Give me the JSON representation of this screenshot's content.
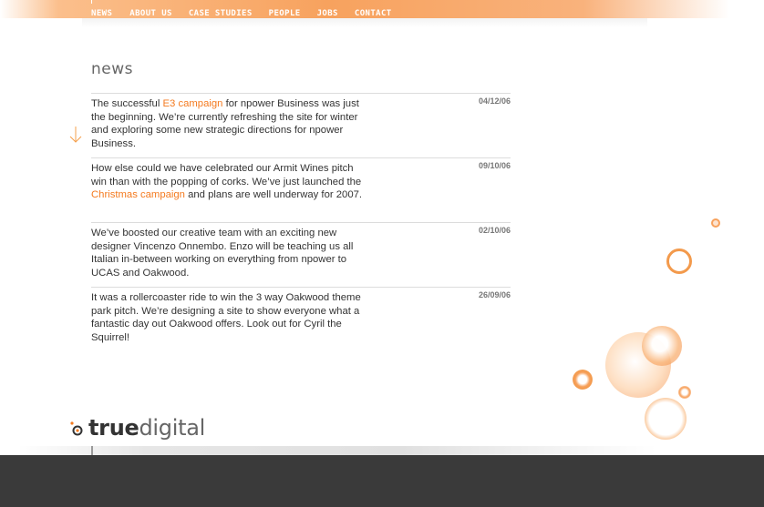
{
  "nav": {
    "items": [
      "NEWS",
      "ABOUT US",
      "CASE STUDIES",
      "PEOPLE",
      "JOBS",
      "CONTACT"
    ]
  },
  "page_title": "news",
  "news": [
    {
      "date": "04/12/06",
      "pre": "The successful ",
      "link": "E3 campaign",
      "post": " for npower Business was just the beginning. We’re currently refreshing the site for winter and exploring some new strategic directions for npower Business."
    },
    {
      "date": "09/10/06",
      "pre": "How else could we have celebrated our Armit Wines pitch win than with the popping of corks. We’ve just launched the ",
      "link": "Christmas campaign",
      "post": " and plans are well underway for 2007."
    },
    {
      "date": "02/10/06",
      "pre": "We’ve boosted our creative team with an exciting new designer Vincenzo Onnembo. Enzo will be teaching us all Italian in-between working on everything from npower to UCAS and Oakwood.",
      "link": "",
      "post": ""
    },
    {
      "date": "26/09/06",
      "pre": "It was a rollercoaster ride to win the 3 way Oakwood theme park pitch. We’re designing a site to show everyone what a fantastic day out Oakwood offers. Look out for Cyril the Squirrel!",
      "link": "",
      "post": ""
    }
  ],
  "logo": {
    "bold": "true",
    "light": "digital"
  },
  "colors": {
    "accent": "#f47a1f",
    "footer": "#3a3a3a",
    "nav_band": "#f7a25e"
  }
}
